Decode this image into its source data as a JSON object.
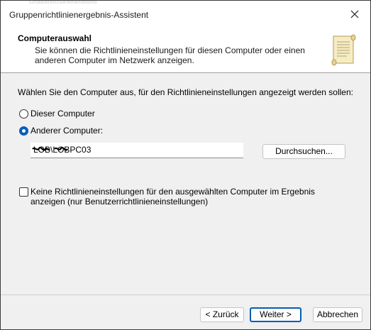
{
  "window": {
    "title": "Gruppenrichtlinienergebnis-Assistent",
    "ghost_text": "Gruppenrichtlinienergebnis",
    "close_glyph": "×"
  },
  "header": {
    "title": "Computerauswahl",
    "description": "Sie können die Richtlinieneinstellungen für diesen Computer oder einen anderen Computer im Netzwerk anzeigen.",
    "icon": "scroll-icon"
  },
  "main": {
    "instruction": "Wählen Sie den Computer aus, für den Richtlinieneinstellungen angezeigt werden sollen:",
    "radio_this": {
      "label": "Dieser Computer",
      "checked": false
    },
    "radio_other": {
      "label": "Anderer Computer:",
      "checked": true
    },
    "computer_input": {
      "value": "LOB\\LOBPC03"
    },
    "browse_button": "Durchsuchen...",
    "exclude_user_checkbox": {
      "label": "Keine Richtlinieneinstellungen für den ausgewählten Computer im Ergebnis anzeigen (nur Benutzerrichtlinieneinstellungen)",
      "checked": false
    }
  },
  "footer": {
    "back_button": "< Zurück",
    "next_button": "Weiter >",
    "cancel_button": "Abbrechen"
  },
  "colors": {
    "accent": "#005fb8",
    "dialog_bg": "#f0f0f0",
    "header_bg": "#ffffff"
  }
}
